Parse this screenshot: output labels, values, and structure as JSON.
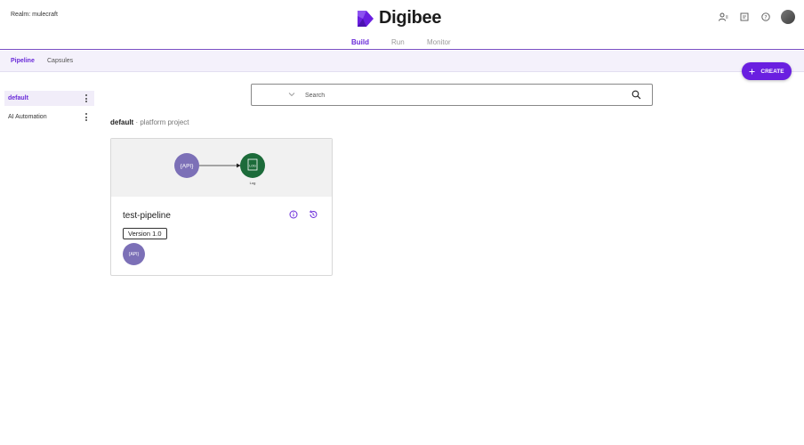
{
  "header": {
    "realm_label": "Realm: mulecraft",
    "logo_text": "Digibee",
    "nav": [
      {
        "label": "Build",
        "active": true
      },
      {
        "label": "Run",
        "active": false
      },
      {
        "label": "Monitor",
        "active": false
      }
    ],
    "icons": [
      "user-switch-icon",
      "document-icon",
      "help-icon",
      "user-avatar"
    ]
  },
  "subnav": {
    "tabs": [
      {
        "label": "Pipeline",
        "active": true
      },
      {
        "label": "Capsules",
        "active": false
      }
    ]
  },
  "create_button": {
    "label": "CREATE",
    "icon": "plus-icon"
  },
  "sidebar": {
    "items": [
      {
        "label": "default",
        "active": true
      },
      {
        "label": "AI Automation",
        "active": false
      }
    ]
  },
  "search": {
    "placeholder": "Search",
    "value": ""
  },
  "breadcrumb": {
    "project": "default",
    "description": "· platform project"
  },
  "pipeline_card": {
    "canvas": {
      "trigger_label": "{API}",
      "step_label": "Log",
      "step_icon_text": "LOG"
    },
    "title": "test-pipeline",
    "version": "Version 1.0",
    "trigger_badge": "{API}"
  },
  "colors": {
    "accent": "#6a2bd9",
    "create_button": "#6a1fe0",
    "trigger_node": "#7c70b7",
    "log_node": "#1c6b3a",
    "subnav_bg": "#f4f1fb"
  }
}
